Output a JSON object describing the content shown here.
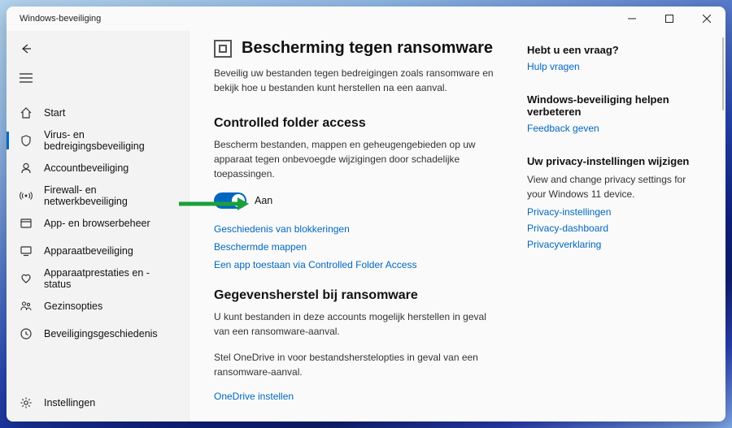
{
  "window": {
    "title": "Windows-beveiliging",
    "minimize_label": "Minimize",
    "maximize_label": "Maximize",
    "close_label": "Close"
  },
  "sidebar": {
    "back_label": "Terug",
    "menu_label": "Menu",
    "items": [
      {
        "label": "Start",
        "icon": "home-icon"
      },
      {
        "label": "Virus- en bedreigingsbeveiliging",
        "icon": "shield-icon"
      },
      {
        "label": "Accountbeveiliging",
        "icon": "account-icon"
      },
      {
        "label": "Firewall- en netwerkbeveiliging",
        "icon": "signal-icon"
      },
      {
        "label": "App- en browserbeheer",
        "icon": "app-icon"
      },
      {
        "label": "Apparaatbeveiliging",
        "icon": "device-icon"
      },
      {
        "label": "Apparaatprestaties en -status",
        "icon": "heart-icon"
      },
      {
        "label": "Gezinsopties",
        "icon": "family-icon"
      },
      {
        "label": "Beveiligingsgeschiedenis",
        "icon": "history-icon"
      }
    ],
    "settings_label": "Instellingen"
  },
  "main": {
    "title": "Bescherming tegen ransomware",
    "lead": "Beveilig uw bestanden tegen bedreigingen zoals ransomware en bekijk hoe u bestanden kunt herstellen na een aanval.",
    "cfa": {
      "heading": "Controlled folder access",
      "desc": "Bescherm bestanden, mappen en geheugengebieden op uw apparaat tegen onbevoegde wijzigingen door schadelijke toepassingen.",
      "toggle_state_label": "Aan",
      "toggle_on": true,
      "links": [
        "Geschiedenis van blokkeringen",
        "Beschermde mappen",
        "Een app toestaan via Controlled Folder Access"
      ]
    },
    "recovery": {
      "heading": "Gegevensherstel bij ransomware",
      "desc": "U kunt bestanden in deze accounts mogelijk herstellen in geval van een ransomware-aanval.",
      "onedrive_note": "Stel OneDrive in voor bestandsherstelopties in geval van een ransomware-aanval.",
      "onedrive_link": "OneDrive instellen"
    }
  },
  "right": {
    "blocks": [
      {
        "heading": "Hebt u een vraag?",
        "links": [
          "Hulp vragen"
        ]
      },
      {
        "heading": "Windows-beveiliging helpen verbeteren",
        "links": [
          "Feedback geven"
        ]
      },
      {
        "heading": "Uw privacy-instellingen wijzigen",
        "desc": "View and change privacy settings for your Windows 11 device.",
        "links": [
          "Privacy-instellingen",
          "Privacy-dashboard",
          "Privacyverklaring"
        ]
      }
    ]
  }
}
